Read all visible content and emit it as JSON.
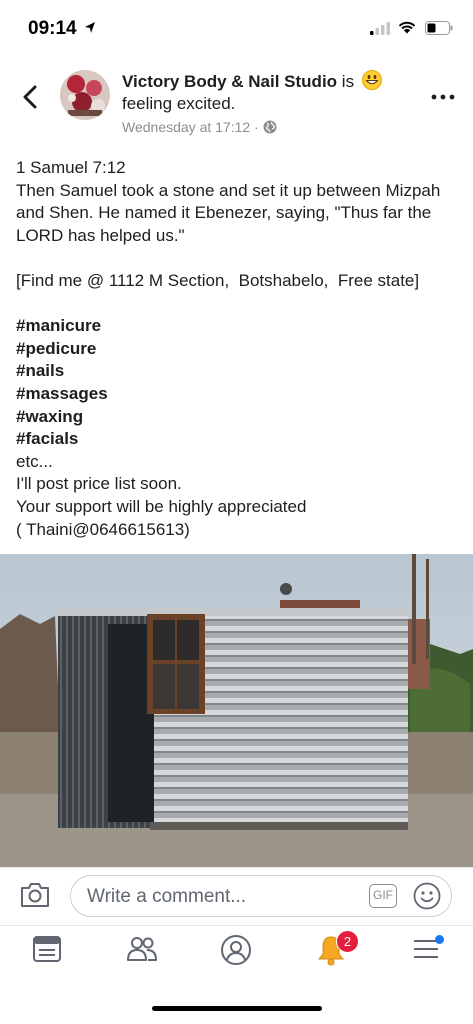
{
  "status_bar": {
    "time": "09:14"
  },
  "post": {
    "page_name": "Victory Body & Nail Studio",
    "is_word": " is",
    "feeling": "feeling excited.",
    "timestamp": "Wednesday at 17:12 ·",
    "body": {
      "scripture": [
        "1 Samuel 7:12",
        "Then Samuel took a stone and set it up between Mizpah and Shen. He named it Ebenezer, saying, \"Thus far the LORD has helped us.\""
      ],
      "location": "[Find me @ 1112 M Section,  Botshabelo,  Free state]",
      "hashtags": [
        "#manicure",
        "#pedicure",
        "#nails",
        "#massages",
        "#waxing",
        "#facials"
      ],
      "closing": [
        "etc...",
        "I'll post price list soon.",
        "Your support will be highly appreciated",
        "( Thaini@0646615613)"
      ]
    }
  },
  "comment_bar": {
    "placeholder": "Write a comment...",
    "gif_label": "GIF"
  },
  "tab_bar": {
    "tabs": [
      "news-feed",
      "friends",
      "profile",
      "notifications",
      "menu"
    ],
    "notification_count": "2"
  },
  "colors": {
    "accent": "#1877f2",
    "badge": "#e41e3f",
    "bell": "#f5a623"
  }
}
